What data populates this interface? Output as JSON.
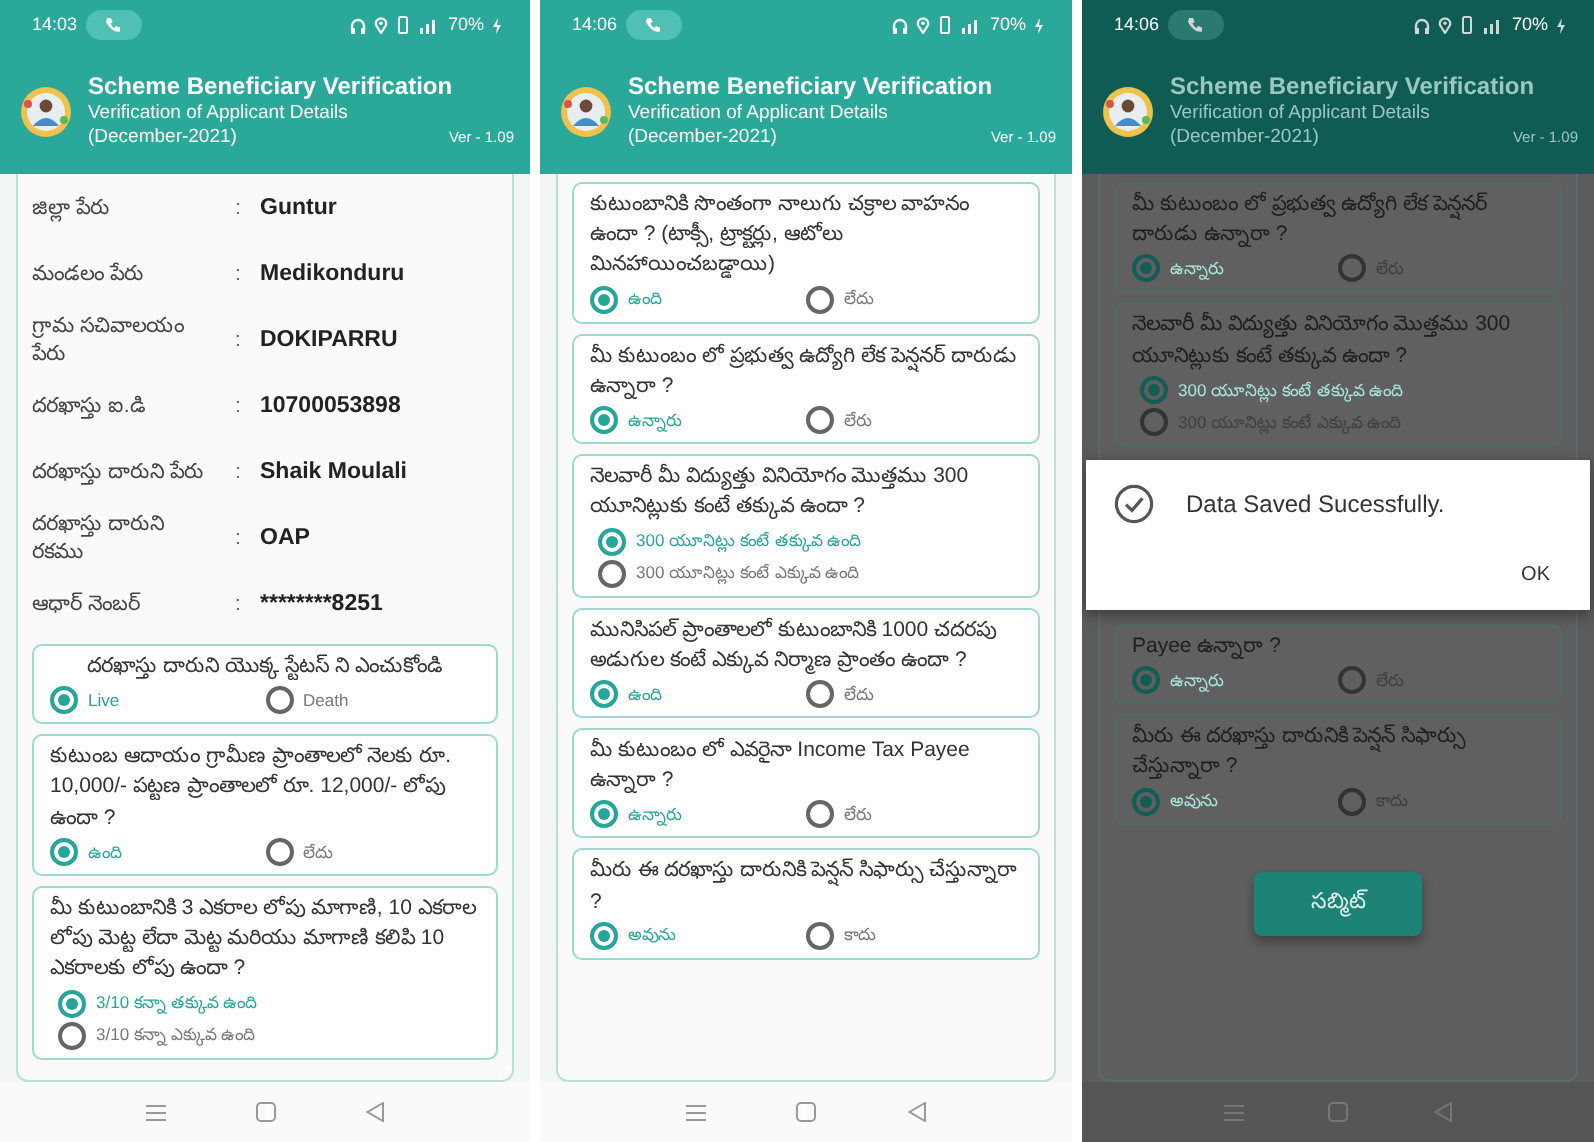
{
  "screens": [
    {
      "dimmed": false,
      "status_bar": {
        "time": "14:03",
        "battery": "70%"
      },
      "header": {
        "title": "Scheme Beneficiary Verification",
        "subtitle": "Verification of Applicant Details",
        "period": "(December-2021)",
        "version": "Ver - 1.09"
      },
      "details": [
        {
          "label": "జిల్లా పేరు",
          "colon": ":",
          "value": "Guntur"
        },
        {
          "label": "మండలం పేరు",
          "colon": ":",
          "value": "Medikonduru"
        },
        {
          "label": "గ్రామ సచివాలయం పేరు",
          "colon": ":",
          "value": "DOKIPARRU"
        },
        {
          "label": "దరఖాస్తు ఐ.డి",
          "colon": ":",
          "value": "10700053898"
        },
        {
          "label": "దరఖాస్తు దారుని పేరు",
          "colon": ":",
          "value": "Shaik Moulali"
        },
        {
          "label": "దరఖాస్తు దారుని రకము",
          "colon": ":",
          "value": "OAP"
        },
        {
          "label": "ఆధార్ నెంబర్",
          "colon": ":",
          "value": "********8251"
        }
      ],
      "items": [
        {
          "kind": "choice",
          "text": "దరఖాస్తు దారుని యొక్క స్టేటస్ ని ఎంచుకోండి",
          "options": [
            {
              "label": "Live",
              "selected": true
            },
            {
              "label": "Death",
              "selected": false
            }
          ]
        },
        {
          "kind": "choice",
          "text": "కుటుంబ ఆదాయం గ్రామీణ ప్రాంతాలలో నెలకు రూ. 10,000/- పట్టణ ప్రాంతాలలో రూ. 12,000/- లోపు ఉందా ?",
          "options": [
            {
              "label": "ఉంది",
              "selected": true
            },
            {
              "label": "లేదు",
              "selected": false
            }
          ]
        },
        {
          "kind": "list-choice",
          "text": "మీ కుటుంబానికి 3 ఎకరాల లోపు మాగాణి, 10 ఎకరాల లోపు మెట్ట లేదా మెట్ట మరియు మాగాణి కలిపి 10 ఎకరాలకు లోపు ఉందా ?",
          "options": [
            {
              "label": "3/10 కన్నా తక్కువ ఉంది",
              "selected": true
            },
            {
              "label": "3/10 కన్నా ఎక్కువ ఉంది",
              "selected": false
            }
          ]
        }
      ]
    },
    {
      "dimmed": false,
      "status_bar": {
        "time": "14:06",
        "battery": "70%"
      },
      "header": {
        "title": "Scheme Beneficiary Verification",
        "subtitle": "Verification of Applicant Details",
        "period": "(December-2021)",
        "version": "Ver - 1.09"
      },
      "items": [
        {
          "kind": "choice",
          "text": "కుటుంబానికి సొంతంగా నాలుగు చక్రాల వాహనం ఉందా ? (టాక్సీ, ట్రాక్టర్లు, ఆటోలు మినహాయించబడ్డాయి)",
          "options": [
            {
              "label": "ఉంది",
              "selected": true
            },
            {
              "label": "లేదు",
              "selected": false
            }
          ]
        },
        {
          "kind": "choice",
          "text": "మీ కుటుంబం లో ప్రభుత్వ ఉద్యోగి లేక పెన్షనర్ దారుడు ఉన్నారా ?",
          "options": [
            {
              "label": "ఉన్నారు",
              "selected": true
            },
            {
              "label": "లేరు",
              "selected": false
            }
          ]
        },
        {
          "kind": "list-choice",
          "text": "నెలవారీ మీ విద్యుత్తు వినియోగం మొత్తము 300 యూనిట్లుకు కంటే తక్కువ ఉందా ?",
          "options": [
            {
              "label": "300 యూనిట్లు కంటే తక్కువ ఉంది",
              "selected": true
            },
            {
              "label": "300 యూనిట్లు కంటే ఎక్కువ ఉంది",
              "selected": false
            }
          ]
        },
        {
          "kind": "choice",
          "text": "మునిసిపల్ ప్రాంతాలలో కుటుంబానికి 1000 చదరపు అడుగుల కంటే ఎక్కువ నిర్మాణ ప్రాంతం ఉందా ?",
          "options": [
            {
              "label": "ఉంది",
              "selected": true
            },
            {
              "label": "లేదు",
              "selected": false
            }
          ]
        },
        {
          "kind": "choice",
          "text": "మీ కుటుంబం లో ఎవరైనా Income Tax Payee ఉన్నారా ?",
          "options": [
            {
              "label": "ఉన్నారు",
              "selected": true
            },
            {
              "label": "లేరు",
              "selected": false
            }
          ]
        },
        {
          "kind": "choice",
          "text": "మీరు ఈ దరఖాస్తు దారునికి పెన్షన్ సిఫార్సు చేస్తున్నారా ?",
          "options": [
            {
              "label": "అవును",
              "selected": true
            },
            {
              "label": "కాదు",
              "selected": false
            }
          ]
        }
      ]
    },
    {
      "dimmed": true,
      "status_bar": {
        "time": "14:06",
        "battery": "70%"
      },
      "header": {
        "title": "Scheme Beneficiary Verification",
        "subtitle": "Verification of Applicant Details",
        "period": "(December-2021)",
        "version": "Ver - 1.09"
      },
      "items": [
        {
          "kind": "choice",
          "text": "మీ కుటుంబం లో ప్రభుత్వ ఉద్యోగి లేక పెన్షనర్ దారుడు ఉన్నారా ?",
          "options": [
            {
              "label": "ఉన్నారు",
              "selected": true
            },
            {
              "label": "లేరు",
              "selected": false
            }
          ]
        },
        {
          "kind": "list-choice",
          "text": "నెలవారీ మీ విద్యుత్తు వినియోగం మొత్తము 300 యూనిట్లుకు కంటే తక్కువ ఉందా ?",
          "options": [
            {
              "label": "300 యూనిట్లు కంటే తక్కువ ఉంది",
              "selected": true
            },
            {
              "label": "300 యూనిట్లు కంటే ఎక్కువ ఉంది",
              "selected": false
            }
          ]
        },
        {
          "kind": "dialog",
          "message": "Data Saved Sucessfully.",
          "button": "OK"
        },
        {
          "kind": "choice",
          "text": "Payee ఉన్నారా ?",
          "options": [
            {
              "label": "ఉన్నారు",
              "selected": true
            },
            {
              "label": "లేరు",
              "selected": false
            }
          ]
        },
        {
          "kind": "choice",
          "text": "మీరు ఈ దరఖాస్తు దారునికి పెన్షన్ సిఫార్సు చేస్తున్నారా ?",
          "options": [
            {
              "label": "అవును",
              "selected": true
            },
            {
              "label": "కాదు",
              "selected": false
            }
          ]
        },
        {
          "kind": "submit",
          "label": "సబ్మిట్"
        }
      ]
    }
  ]
}
